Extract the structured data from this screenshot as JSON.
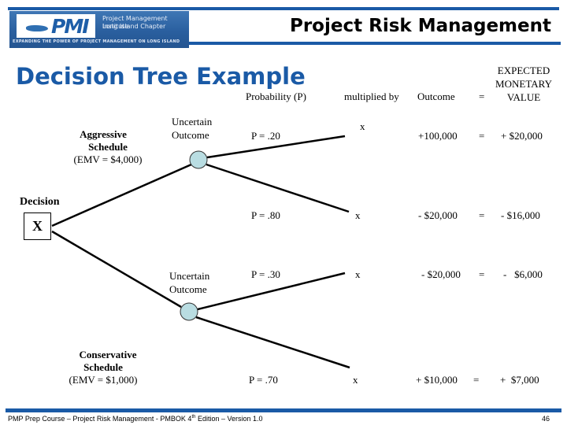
{
  "header": {
    "logo": {
      "mark": "PMI",
      "org_line1": "Project Management Institute",
      "org_line2": "Long Island Chapter",
      "tagline": "EXPANDING THE POWER OF PROJECT MANAGEMENT ON LONG ISLAND"
    },
    "title": "Project Risk Management",
    "accent_color": "#1a5aa6"
  },
  "slide": {
    "title": "Decision Tree Example",
    "columns": {
      "probability": "Probability (P)",
      "multiplied_by": "multiplied by",
      "outcome": "Outcome",
      "equals": "=",
      "emv_line1": "EXPECTED",
      "emv_line2": "MONETARY",
      "emv_line3": "VALUE"
    },
    "decision": {
      "label": "Decision",
      "symbol": "X"
    },
    "options": [
      {
        "name_line1": "Aggressive",
        "name_line2": "Schedule",
        "emv": "(EMV = $4,000)",
        "chance_label_line1": "Uncertain",
        "chance_label_line2": "Outcome",
        "branches": [
          {
            "probability": "P = .20",
            "times": "x",
            "outcome": "+100,000",
            "equals": "=",
            "emv": "+ $20,000"
          },
          {
            "probability": "P = .80",
            "times": "x",
            "outcome": "- $20,000",
            "equals": "=",
            "emv": "- $16,000"
          }
        ]
      },
      {
        "name_line1": "Conservative",
        "name_line2": "Schedule",
        "emv": "(EMV = $1,000)",
        "chance_label_line1": "Uncertain",
        "chance_label_line2": "Outcome",
        "branches": [
          {
            "probability": "P = .30",
            "times": "x",
            "outcome": "- $20,000",
            "equals": "=",
            "emv": "-   $6,000"
          },
          {
            "probability": "P = .70",
            "times": "x",
            "outcome": "+ $10,000",
            "equals": "=",
            "emv": "+  $7,000"
          }
        ]
      }
    ],
    "chance_node_color": "#b9dde2"
  },
  "footer": {
    "text_before_sup": "PMP Prep Course – Project Risk Management - PMBOK 4",
    "sup": "th",
    "text_after_sup": " Edition – Version 1.0",
    "page_number": "46"
  }
}
